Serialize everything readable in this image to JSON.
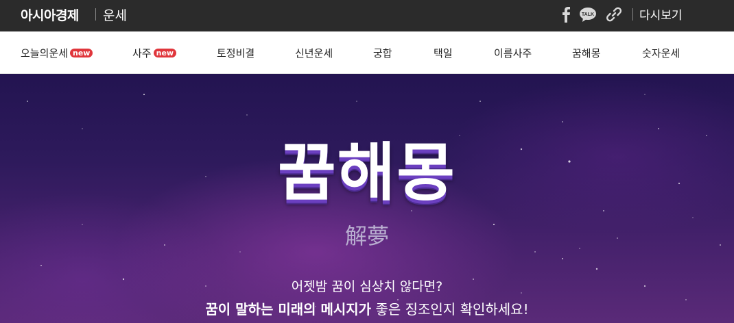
{
  "header": {
    "brand": "아시아경제",
    "section": "운세",
    "icons": [
      "facebook-icon",
      "kakaotalk-icon",
      "link-icon"
    ],
    "talk_label": "TALK",
    "replay_label": "다시보기"
  },
  "nav": {
    "items": [
      {
        "label": "오늘의운세",
        "badge": "new"
      },
      {
        "label": "사주",
        "badge": "new"
      },
      {
        "label": "토정비결"
      },
      {
        "label": "신년운세"
      },
      {
        "label": "궁합"
      },
      {
        "label": "택일"
      },
      {
        "label": "이름사주"
      },
      {
        "label": "꿈해몽"
      },
      {
        "label": "숫자운세"
      }
    ]
  },
  "hero": {
    "title": "꿈해몽",
    "hanja": "解夢",
    "line1": "어젯밤 꿈이 심상치 않다면?",
    "line2_bold": "꿈이 말하는 미래의 메시지가",
    "line2_rest": " 좋은 징조인지 확인하세요!"
  },
  "colors": {
    "topbar": "#2b2b2b",
    "badge": "#e0363c",
    "hero_dark": "#231451",
    "hero_light": "#5a2a78",
    "title_shadow": "#6b3fc0"
  }
}
